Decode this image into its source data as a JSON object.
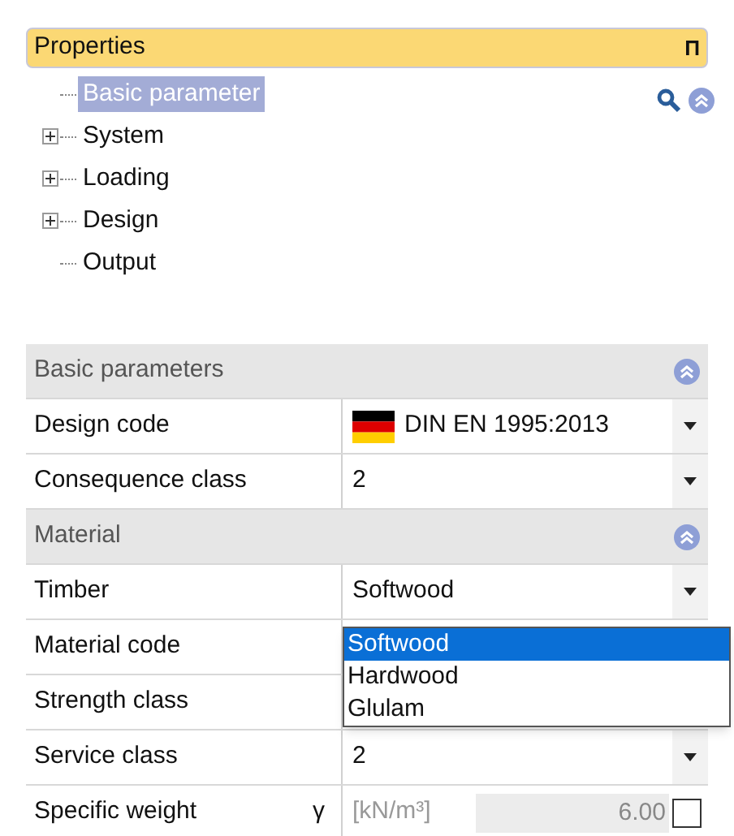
{
  "panel": {
    "title": "Properties",
    "pin": "Π"
  },
  "tree": [
    {
      "label": "Basic parameter",
      "selected": true,
      "expandable": false
    },
    {
      "label": "System",
      "selected": false,
      "expandable": true
    },
    {
      "label": "Loading",
      "selected": false,
      "expandable": true
    },
    {
      "label": "Design",
      "selected": false,
      "expandable": true
    },
    {
      "label": "Output",
      "selected": false,
      "expandable": false
    }
  ],
  "sections": [
    {
      "title": "Basic parameters",
      "rows": [
        {
          "kind": "dropdown",
          "label": "Design code",
          "value": "DIN EN 1995:2013",
          "flag": true
        },
        {
          "kind": "dropdown",
          "label": "Consequence class",
          "value": "2",
          "flag": false
        }
      ]
    },
    {
      "title": "Material",
      "rows": [
        {
          "kind": "dropdown",
          "label": "Timber",
          "value": "Softwood",
          "flag": false
        },
        {
          "kind": "hidden",
          "label": "Material code"
        },
        {
          "kind": "hidden",
          "label": "Strength class"
        },
        {
          "kind": "dropdown",
          "label": "Service class",
          "value": "2",
          "flag": false
        },
        {
          "kind": "unit",
          "label": "Specific weight",
          "symbol": "γ",
          "unit": "[kN/m³]",
          "value": "6.00",
          "checked": false
        }
      ]
    }
  ],
  "open_list": {
    "options": [
      {
        "label": "Softwood",
        "selected": true
      },
      {
        "label": "Hardwood",
        "selected": false
      },
      {
        "label": "Glulam",
        "selected": false
      }
    ]
  }
}
